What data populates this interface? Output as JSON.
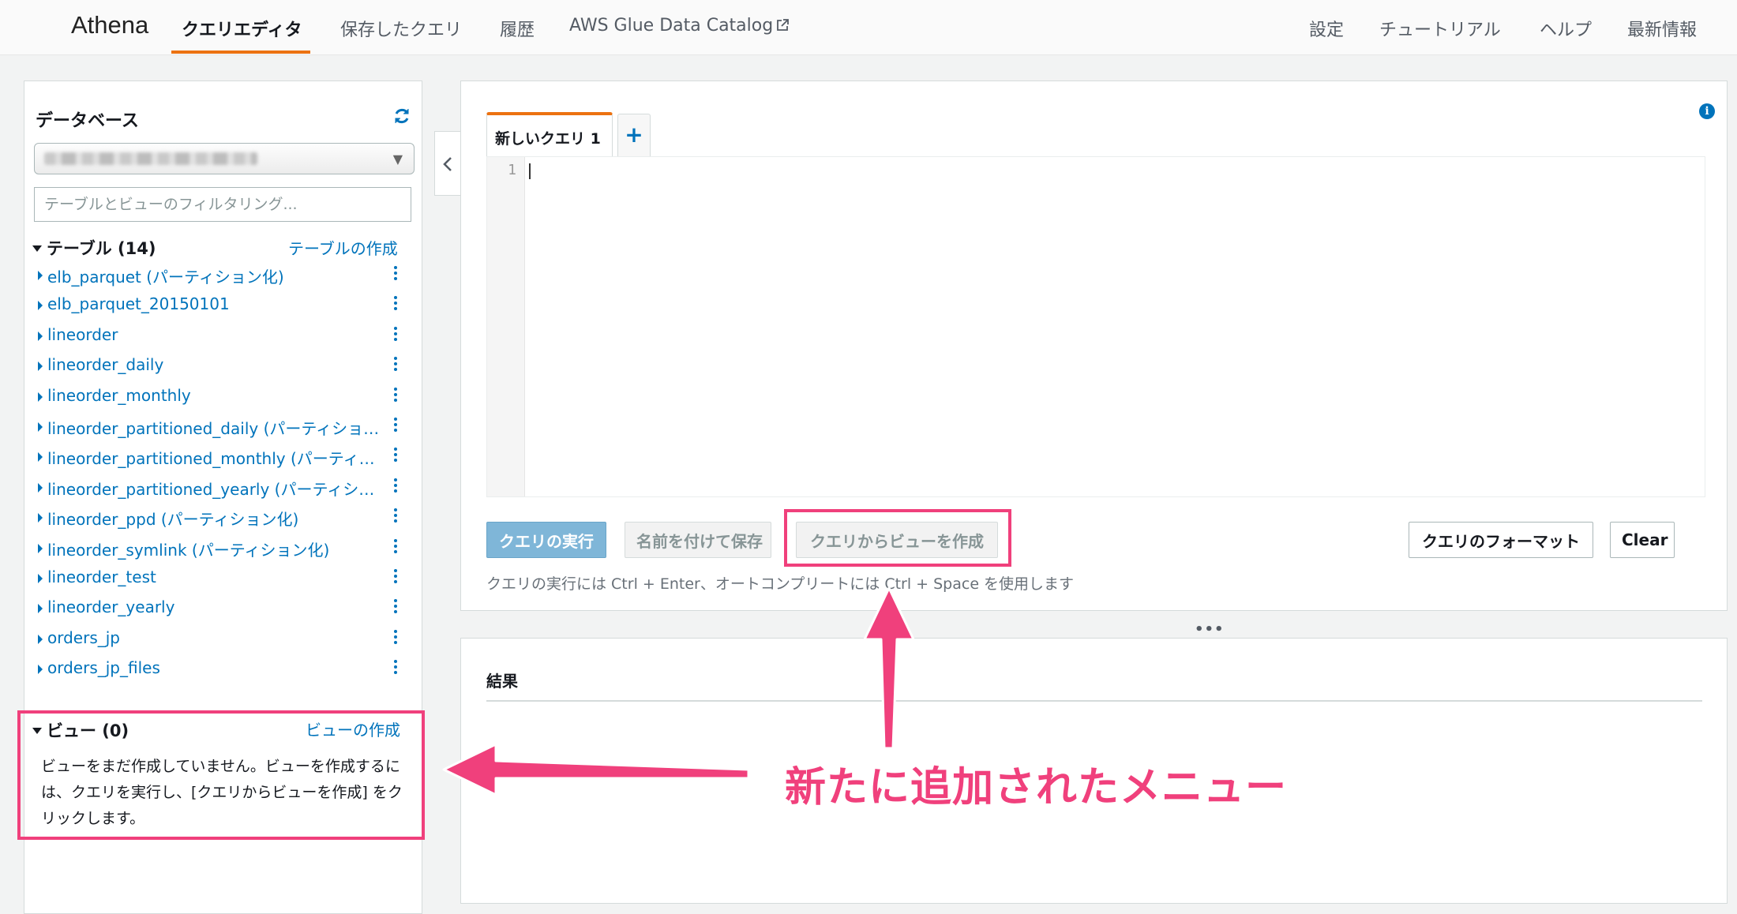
{
  "app": {
    "brand": "Athena"
  },
  "nav": {
    "left": [
      "クエリエディタ",
      "保存したクエリ",
      "履歴",
      "AWS Glue Data Catalog"
    ],
    "right": [
      "設定",
      "チュートリアル",
      "ヘルプ",
      "最新情報"
    ],
    "active_index": 0
  },
  "sidebar": {
    "database_title": "データベース",
    "filter_placeholder": "テーブルとビューのフィルタリング...",
    "tables_header": "テーブル (14)",
    "create_table_link": "テーブルの作成",
    "tables": [
      "elb_parquet (パーティション化)",
      "elb_parquet_20150101",
      "lineorder",
      "lineorder_daily",
      "lineorder_monthly",
      "lineorder_partitioned_daily (パーティション化)",
      "lineorder_partitioned_monthly (パーティション化)",
      "lineorder_partitioned_yearly (パーティション化)",
      "lineorder_ppd (パーティション化)",
      "lineorder_symlink (パーティション化)",
      "lineorder_test",
      "lineorder_yearly",
      "orders_jp",
      "orders_jp_files"
    ],
    "views_header": "ビュー (0)",
    "create_view_link": "ビューの作成",
    "views_empty_text": "ビューをまだ作成していません。ビューを作成するには、クエリを実行し、[クエリからビューを作成] をクリックします。"
  },
  "editor": {
    "tab_label": "新しいクエリ 1",
    "add_tab_label": "+",
    "line_number": "1",
    "buttons": {
      "run": "クエリの実行",
      "save_as": "名前を付けて保存",
      "create_view": "クエリからビューを作成",
      "format": "クエリのフォーマット",
      "clear": "Clear"
    },
    "hint": "クエリの実行には Ctrl + Enter、オートコンプリートには Ctrl + Space を使用します",
    "info_icon": "i"
  },
  "results": {
    "title": "結果"
  },
  "annotation": {
    "text": "新たに追加されたメニュー",
    "color": "#f0407c"
  },
  "colors": {
    "accent": "#ec7211",
    "link": "#0073bb",
    "highlight": "#f0407c"
  },
  "icons": [
    "refresh-icon",
    "external-link-icon",
    "chevron-left-icon",
    "info-icon",
    "kebab-menu-icon",
    "caret-down-icon"
  ]
}
